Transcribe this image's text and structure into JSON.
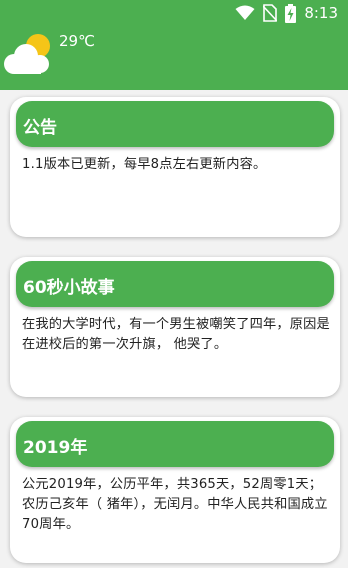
{
  "status_bar": {
    "time": "8:13",
    "icons": [
      "wifi-icon",
      "no-sim-icon",
      "battery-charging-icon"
    ]
  },
  "weather": {
    "icon": "partly-cloudy-icon",
    "temperature": "29℃"
  },
  "cards": [
    {
      "title": "公告",
      "content": "1.1版本已更新，每早8点左右更新内容。"
    },
    {
      "title": "60秒小故事",
      "content": "在我的大学时代，有一个男生被嘲笑了四年，原因是在进校后的第一次升旗， 他哭了。"
    },
    {
      "title": "2019年",
      "content": "公元2019年，公历平年，共365天，52周零1天；农历己亥年（ 猪年），无闰月。中华人民共和国成立70周年。"
    }
  ],
  "colors": {
    "primary": "#4caf50",
    "background": "#f2f2f2",
    "card": "#ffffff",
    "sun": "#f5c518",
    "cloud": "#ffffff"
  }
}
